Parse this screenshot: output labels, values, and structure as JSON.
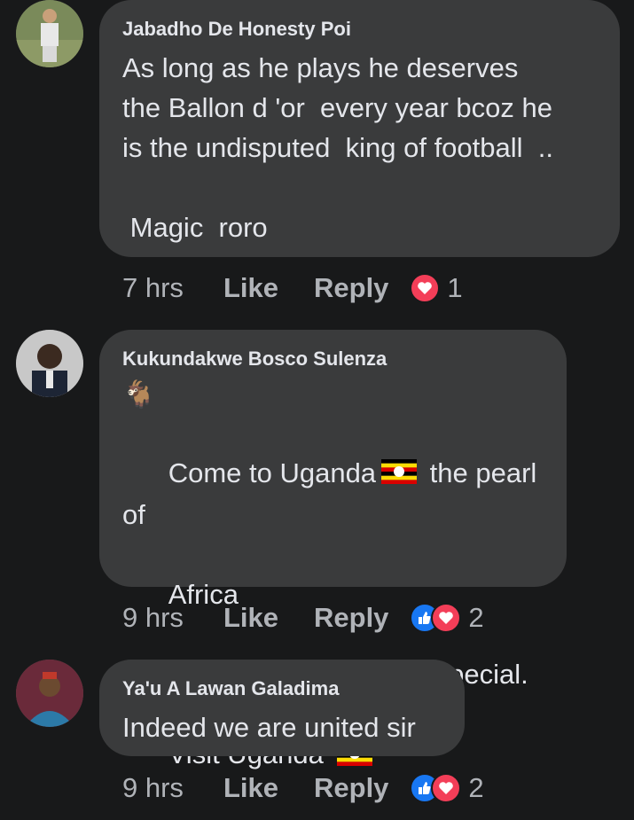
{
  "comments": [
    {
      "author": "Jabadho De Honesty Poi",
      "text": "As long as he plays he deserves\nthe Ballon d 'or  every year bcoz he\nis the undisputed  king of football  ..\n\n Magic  roro",
      "time": "7 hrs",
      "like_label": "Like",
      "reply_label": "Reply",
      "reactions": [
        "love"
      ],
      "reaction_count": "1"
    },
    {
      "author": "Kukundakwe Bosco Sulenza",
      "emoji": "🐐",
      "line1a": "Come to Uganda",
      "line1b": " the pearl of",
      "line2": "Africa",
      "line3": "We shall as well treat special.",
      "line4": "Visit Uganda ",
      "time": "9 hrs",
      "like_label": "Like",
      "reply_label": "Reply",
      "reactions": [
        "like",
        "love"
      ],
      "reaction_count": "2"
    },
    {
      "author": "Ya'u A Lawan Galadima",
      "text": "Indeed we are united sir",
      "time": "9 hrs",
      "like_label": "Like",
      "reply_label": "Reply",
      "reactions": [
        "like",
        "love"
      ],
      "reaction_count": "2"
    }
  ],
  "colors": {
    "background": "#18191a",
    "bubble": "#3a3b3c",
    "text": "#e4e6eb",
    "muted": "#b0b3b8",
    "like_blue": "#1877f2",
    "love_red": "#f33e58"
  }
}
